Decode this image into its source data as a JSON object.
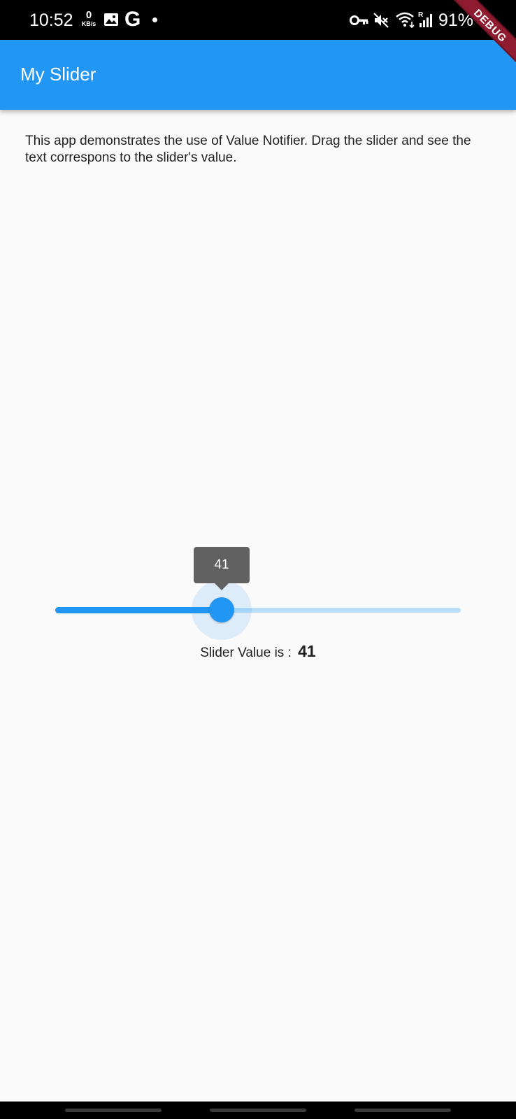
{
  "status_bar": {
    "time": "10:52",
    "net_speed_value": "0",
    "net_speed_unit": "KB/s",
    "battery_percent": "91%",
    "icons": [
      "gallery-icon",
      "google-icon",
      "notification-dot-icon",
      "vpn-key-icon",
      "mute-icon",
      "wifi-icon",
      "signal-icon",
      "battery-icon"
    ]
  },
  "debug_banner": "DEBUG",
  "app_bar": {
    "title": "My Slider",
    "color": "#2196f3"
  },
  "description": "This app demonstrates the use of Value Notifier. Drag the slider and see the text correspons to the slider's value.",
  "slider": {
    "value": 41,
    "min": 0,
    "max": 100,
    "indicator_label": "41",
    "active_color": "#2196f3",
    "inactive_color": "#bbdefb"
  },
  "value_text": {
    "prefix": "Slider Value is : ",
    "value": "41"
  }
}
